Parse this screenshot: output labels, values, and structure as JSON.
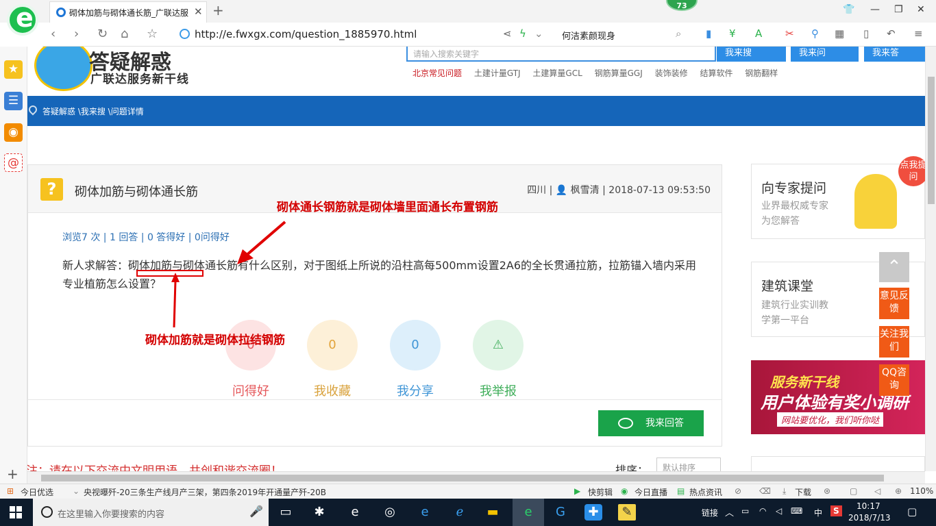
{
  "browser": {
    "tab_title": "砌体加筋与砌体通长筋_广联达服",
    "badge": "73",
    "url": "http://e.fwxgx.com/question_1885970.html",
    "news_ticker": "何洁素颜现身"
  },
  "site": {
    "logo_line1": "答疑解惑",
    "logo_line2": "广联达服务新干线",
    "search_placeholder": "请输入搜索关键字",
    "btn_search": "我来搜",
    "btn_ask": "我来问",
    "btn_answer": "我来答",
    "quicklinks": [
      "北京常见问题",
      "土建计量GTJ",
      "土建算量GCL",
      "钢筋算量GGJ",
      "装饰装修",
      "结算软件",
      "钢筋翻样"
    ],
    "breadcrumb": "答疑解惑 \\我来搜 \\问题详情"
  },
  "question": {
    "title": "砌体加筋与砌体通长筋",
    "meta": "四川 | 👤 枫雪清 | 2018-07-13 09:53:50",
    "stats": "浏览7 次 | 1 回答 | 0 答得好 | 0问得好",
    "body": "新人求解答：砌体加筋与砌体通长筋有什么区别，对于图纸上所说的沿柱高每500mm设置2A6的全长贯通拉筋，拉筋锚入墙内采用专业植筋怎么设置？",
    "actions": [
      {
        "label": "问得好",
        "count": "0"
      },
      {
        "label": "我收藏",
        "count": "0"
      },
      {
        "label": "我分享",
        "count": "0"
      },
      {
        "label": "我举报",
        "count": ""
      }
    ],
    "answer_button": "我来回答",
    "notice": "注：请在以下交流中文明用语，共创和谐交流圈！",
    "sort_label": "排序：",
    "sort_value": "默认排序"
  },
  "annotations": {
    "top": "砌体通长钢筋就是砌体墙里面通长布置钢筋",
    "bottom": "砌体加筋就是砌体拉结钢筋"
  },
  "right": {
    "expert_title": "向专家提问",
    "expert_sub1": "业界最权威专家",
    "expert_sub2": "为您解答",
    "expert_bubble": "点我提问",
    "course_title": "建筑课堂",
    "course_sub1": "建筑行业实训教",
    "course_sub2": "学第一平台",
    "banner_l1": "服务新干线",
    "banner_l2": "用户体验有奖小调研",
    "banner_l3": "网站要优化，我们听你哒"
  },
  "float_buttons": [
    "意见反馈",
    "关注我们",
    "QQ咨询"
  ],
  "statusbar": {
    "today": "今日优选",
    "news": "央视曝歼-20三条生产线月产三架，第四条2019年开通量产歼-20B",
    "quick_cut": "快剪辑",
    "live": "今日直播",
    "hot": "热点资讯",
    "download": "下载",
    "zoom": "110%"
  },
  "taskbar": {
    "search_placeholder": "在这里输入你要搜索的内容",
    "link": "链接",
    "ime": "中",
    "time": "10:17",
    "date": "2018/7/13"
  }
}
